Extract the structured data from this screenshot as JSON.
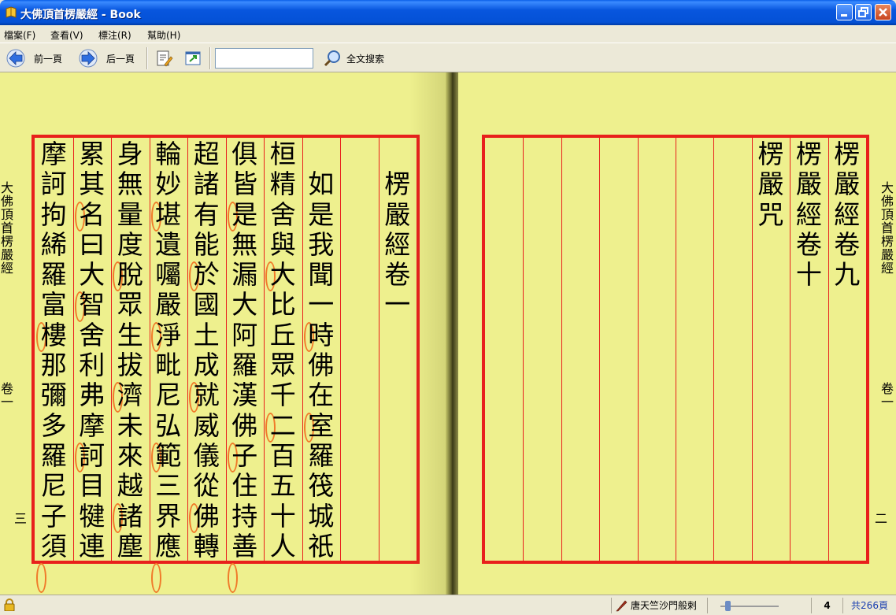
{
  "window": {
    "title": "大佛頂首楞嚴經 - Book"
  },
  "menu": [
    "檔案(F)",
    "查看(V)",
    "標注(R)",
    "幫助(H)"
  ],
  "toolbar": {
    "prev_label": "前一頁",
    "next_label": "后一頁",
    "search_value": "",
    "search_label": "全文搜索"
  },
  "left_page": {
    "margin_title": "大佛頂首楞嚴經",
    "margin_volume": "卷一",
    "page_number": "三",
    "columns": [
      {
        "text": "楞嚴經卷一",
        "offset": 1,
        "marks": []
      },
      {
        "text": "",
        "offset": 0,
        "marks": []
      },
      {
        "text": "如是我聞一時佛在室羅筏城祇",
        "offset": 1,
        "marks": [
          4,
          7,
          13
        ]
      },
      {
        "text": "桓精舍與大比丘眾千二百五十人",
        "offset": 0,
        "marks": [
          3,
          8
        ]
      },
      {
        "text": "俱皆是無漏大阿羅漢佛子住持善",
        "offset": 0,
        "marks": [
          1,
          9,
          13
        ]
      },
      {
        "text": "超諸有能於國土成就威儀從佛轉",
        "offset": 0,
        "marks": [
          3,
          7,
          11
        ]
      },
      {
        "text": "輪妙堪遺囑嚴淨毗尼弘範三界應",
        "offset": 0,
        "marks": [
          1,
          5,
          9,
          13
        ]
      },
      {
        "text": "身無量度脫眾生拔濟未來越諸塵",
        "offset": 0,
        "marks": [
          3,
          7,
          11
        ]
      },
      {
        "text": "累其名曰大智舍利弗摩訶目犍連",
        "offset": 0,
        "marks": [
          1,
          4,
          9,
          14
        ]
      },
      {
        "text": "摩訶拘絺羅富樓那彌多羅尼子須",
        "offset": 0,
        "marks": [
          5,
          13
        ]
      }
    ]
  },
  "right_page": {
    "margin_title": "大佛頂首楞嚴經",
    "margin_volume": "卷一",
    "page_number": "二",
    "columns": [
      {
        "text": "楞嚴經卷九"
      },
      {
        "text": "楞嚴經卷十"
      },
      {
        "text": "楞嚴咒"
      },
      {
        "text": ""
      },
      {
        "text": ""
      },
      {
        "text": ""
      },
      {
        "text": ""
      },
      {
        "text": ""
      },
      {
        "text": ""
      },
      {
        "text": ""
      }
    ]
  },
  "status": {
    "translator": "唐天竺沙門般剌",
    "current_page": "4",
    "total_pages": "共266頁"
  },
  "colors": {
    "page": "#eef08e",
    "grid": "#e8201c",
    "mark": "#f07a2a",
    "titlebar": "#0856de"
  }
}
